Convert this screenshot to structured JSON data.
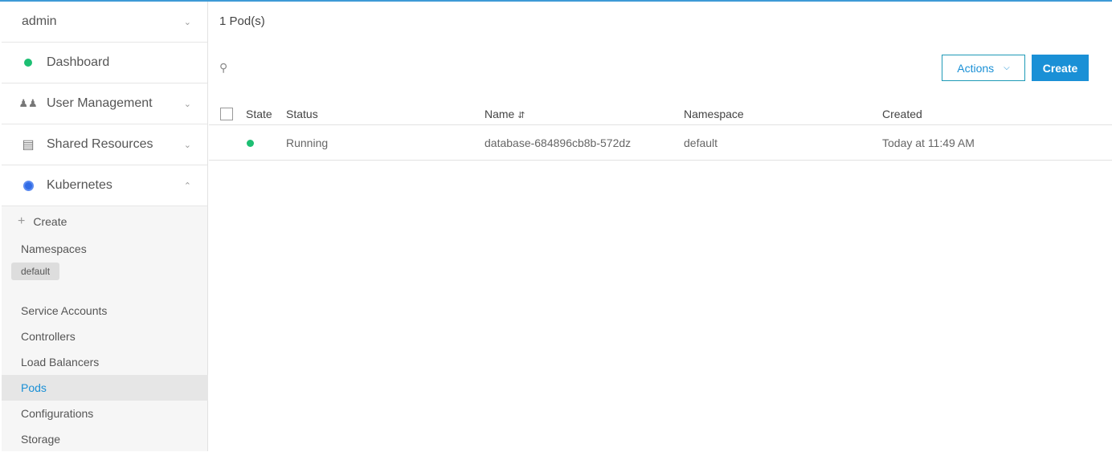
{
  "sidebar": {
    "user": "admin",
    "items": [
      {
        "label": "Dashboard",
        "icon": "dashboard-dot-icon"
      },
      {
        "label": "User Management",
        "icon": "users-icon"
      },
      {
        "label": "Shared Resources",
        "icon": "shared-resources-icon"
      },
      {
        "label": "Kubernetes",
        "icon": "kubernetes-icon"
      }
    ],
    "sub": {
      "create": "Create",
      "namespaces": "Namespaces",
      "namespace_chip": "default",
      "items": [
        "Service Accounts",
        "Controllers",
        "Load Balancers",
        "Pods",
        "Configurations",
        "Storage"
      ],
      "active": "Pods"
    }
  },
  "main": {
    "title": "1 Pod(s)",
    "actions_label": "Actions",
    "create_label": "Create",
    "columns": [
      "State",
      "Status",
      "Name",
      "Namespace",
      "Created"
    ],
    "rows": [
      {
        "state": "running",
        "status": "Running",
        "name": "database-684896cb8b-572dz",
        "namespace": "default",
        "created": "Today at 11:49 AM"
      }
    ]
  },
  "colors": {
    "accent": "#1a90d6",
    "running": "#1dbf73"
  }
}
